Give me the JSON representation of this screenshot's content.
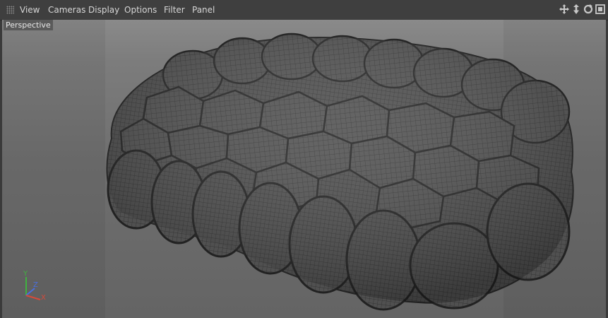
{
  "menubar": {
    "items": [
      "View",
      "Cameras",
      "Display",
      "Options",
      "Filter",
      "Panel"
    ]
  },
  "nav_icons": [
    "move-icon",
    "zoom-icon",
    "rotate-icon",
    "maximize-icon"
  ],
  "viewport": {
    "label": "Perspective"
  },
  "axis_gizmo": {
    "y": "Y",
    "z": "Z",
    "x": "X"
  },
  "colors": {
    "menubar": "#3f3f3f",
    "viewport": "#7a7a7a",
    "axis_y": "#3fb23f",
    "axis_z": "#4a6fe0",
    "axis_x": "#d84a3a",
    "mesh": "#4b4b4b"
  }
}
